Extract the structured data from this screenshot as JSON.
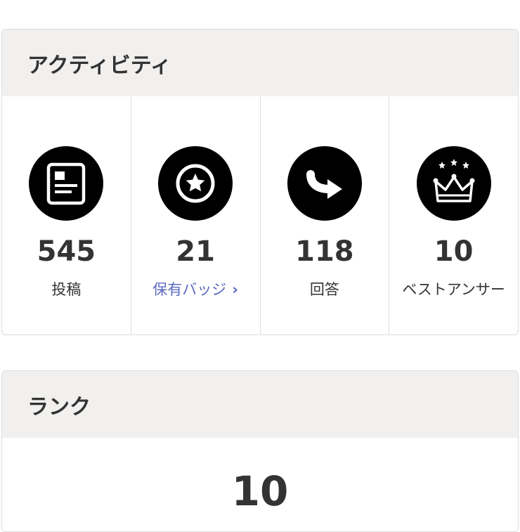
{
  "activity": {
    "title": "アクティビティ",
    "stats": [
      {
        "icon": "document-icon",
        "value": "545",
        "label": "投稿"
      },
      {
        "icon": "star-badge-icon",
        "value": "21",
        "label": "保有バッジ",
        "chevron": "›"
      },
      {
        "icon": "reply-arrow-icon",
        "value": "118",
        "label": "回答"
      },
      {
        "icon": "crown-icon",
        "value": "10",
        "label": "ベストアンサー"
      }
    ]
  },
  "rank": {
    "title": "ランク",
    "value": "10"
  },
  "colors": {
    "header_bg": "#f1f0ef",
    "icon_bg": "#000000",
    "link": "#5c6bc0",
    "text": "#333333"
  }
}
